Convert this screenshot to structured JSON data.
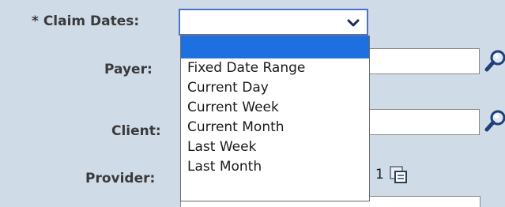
{
  "form": {
    "claim_dates": {
      "required_marker": "*",
      "label": "Claim Dates:",
      "selected_value": "",
      "options": [
        "",
        "Fixed Date Range",
        "Current Day",
        "Current Week",
        "Current Month",
        "Last Week",
        "Last Month"
      ]
    },
    "payer": {
      "label": "Payer:",
      "value": "",
      "lookup_icon": "magnifier-icon"
    },
    "client": {
      "label": "Client:",
      "value": "",
      "lookup_icon": "magnifier-icon"
    },
    "provider": {
      "label": "Provider:",
      "count": "1",
      "copy_icon": "copy-icon"
    }
  },
  "colors": {
    "background": "#cfdbe7",
    "highlight": "#1e6fe0",
    "focus_border": "#4a74c9"
  }
}
